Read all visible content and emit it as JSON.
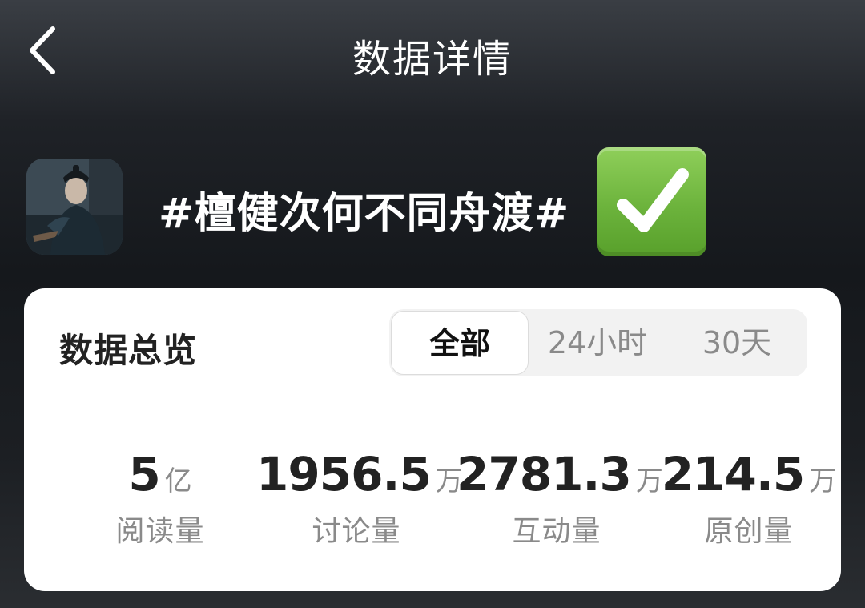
{
  "header": {
    "title": "数据详情",
    "back_icon": "chevron-left-icon"
  },
  "topic": {
    "title": "#檀健次何不同舟渡#",
    "badge_icon": "check-mark-button-icon",
    "badge_color": "#6cb33c"
  },
  "overview": {
    "title": "数据总览",
    "tabs": [
      {
        "label": "全部",
        "selected": true
      },
      {
        "label": "24小时",
        "selected": false
      },
      {
        "label": "30天",
        "selected": false
      }
    ],
    "stats": [
      {
        "value": "5",
        "unit": "亿",
        "label": "阅读量"
      },
      {
        "value": "1956.5",
        "unit": "万",
        "label": "讨论量"
      },
      {
        "value": "2781.3",
        "unit": "万",
        "label": "互动量"
      },
      {
        "value": "214.5",
        "unit": "万",
        "label": "原创量"
      }
    ]
  },
  "colors": {
    "card_background": "#ffffff",
    "primary_text": "#222222",
    "secondary_text": "#8a8a8a"
  }
}
